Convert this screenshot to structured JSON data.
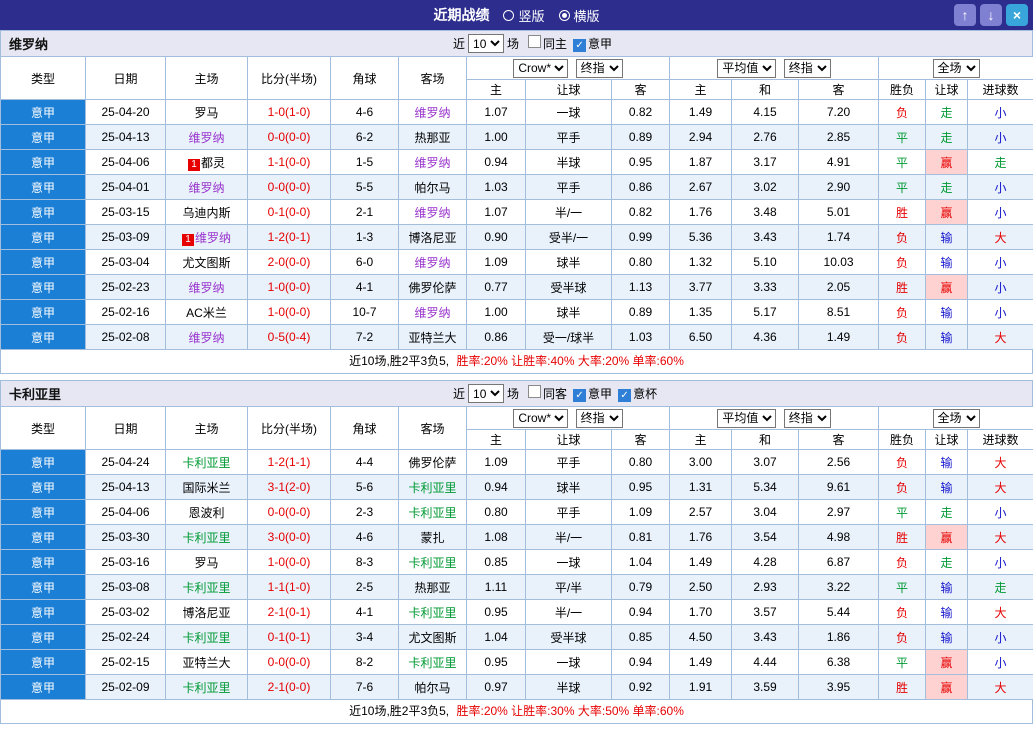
{
  "titlebar": {
    "title": "近期战绩",
    "radios": [
      {
        "label": "竖版",
        "selected": false
      },
      {
        "label": "横版",
        "selected": true
      }
    ],
    "up_icon": "↑",
    "down_icon": "↓",
    "close_icon": "×"
  },
  "colors": {
    "titlebar_bg": "#2d2d8e",
    "league_cell_bg": "#1b7fd6",
    "row_alt_bg": "#e9f2fb",
    "grid_border": "#a3bedc",
    "win_red": "#e60000",
    "draw_green": "#009933",
    "lose_blue": "#1414cc",
    "highlight_pink": "#ffd2d2",
    "team1_color": "#9933cc",
    "team2_color": "#009933"
  },
  "tables": [
    {
      "team": "维罗纳",
      "team_color": "#9933cc",
      "filters": {
        "near_label": "近",
        "count": "10",
        "games_label": "场",
        "checks": [
          {
            "label": "同主",
            "checked": false
          },
          {
            "label": "意甲",
            "checked": true
          }
        ]
      },
      "selects": {
        "g1a": "Crow*",
        "g1b": "终指",
        "g2a": "平均值",
        "g2b": "终指",
        "g3a": "全场"
      },
      "headers": {
        "left": [
          "类型",
          "日期",
          "主场",
          "比分(半场)",
          "角球",
          "客场"
        ],
        "sub": [
          "主",
          "让球",
          "客",
          "主",
          "和",
          "客",
          "胜负",
          "让球",
          "进球数"
        ]
      },
      "rows": [
        {
          "league": "意甲",
          "date": "25-04-20",
          "home": "罗马",
          "home_team": false,
          "home_badge": "",
          "score": "1-0(1-0)",
          "corner": "4-6",
          "away": "维罗纳",
          "away_team": true,
          "away_badge": "",
          "odds": [
            "1.07",
            "一球",
            "0.82"
          ],
          "avg": [
            "1.49",
            "4.15",
            "7.20"
          ],
          "results": [
            {
              "text": "负",
              "color": "red"
            },
            {
              "text": "走",
              "color": "green"
            },
            {
              "text": "小",
              "color": "blue"
            }
          ]
        },
        {
          "league": "意甲",
          "date": "25-04-13",
          "home": "维罗纳",
          "home_team": true,
          "home_badge": "",
          "score": "0-0(0-0)",
          "corner": "6-2",
          "away": "热那亚",
          "away_team": false,
          "away_badge": "",
          "odds": [
            "1.00",
            "平手",
            "0.89"
          ],
          "avg": [
            "2.94",
            "2.76",
            "2.85"
          ],
          "results": [
            {
              "text": "平",
              "color": "green"
            },
            {
              "text": "走",
              "color": "green"
            },
            {
              "text": "小",
              "color": "blue"
            }
          ]
        },
        {
          "league": "意甲",
          "date": "25-04-06",
          "home": "都灵",
          "home_team": false,
          "home_badge": "1",
          "score": "1-1(0-0)",
          "corner": "1-5",
          "away": "维罗纳",
          "away_team": true,
          "away_badge": "",
          "odds": [
            "0.94",
            "半球",
            "0.95"
          ],
          "avg": [
            "1.87",
            "3.17",
            "4.91"
          ],
          "results": [
            {
              "text": "平",
              "color": "green"
            },
            {
              "text": "赢",
              "color": "red",
              "hl": true
            },
            {
              "text": "走",
              "color": "green"
            }
          ]
        },
        {
          "league": "意甲",
          "date": "25-04-01",
          "home": "维罗纳",
          "home_team": true,
          "home_badge": "",
          "score": "0-0(0-0)",
          "corner": "5-5",
          "away": "帕尔马",
          "away_team": false,
          "away_badge": "",
          "odds": [
            "1.03",
            "平手",
            "0.86"
          ],
          "avg": [
            "2.67",
            "3.02",
            "2.90"
          ],
          "results": [
            {
              "text": "平",
              "color": "green"
            },
            {
              "text": "走",
              "color": "green"
            },
            {
              "text": "小",
              "color": "blue"
            }
          ]
        },
        {
          "league": "意甲",
          "date": "25-03-15",
          "home": "乌迪内斯",
          "home_team": false,
          "home_badge": "",
          "score": "0-1(0-0)",
          "corner": "2-1",
          "away": "维罗纳",
          "away_team": true,
          "away_badge": "",
          "odds": [
            "1.07",
            "半/一",
            "0.82"
          ],
          "avg": [
            "1.76",
            "3.48",
            "5.01"
          ],
          "results": [
            {
              "text": "胜",
              "color": "red"
            },
            {
              "text": "赢",
              "color": "red",
              "hl": true
            },
            {
              "text": "小",
              "color": "blue"
            }
          ]
        },
        {
          "league": "意甲",
          "date": "25-03-09",
          "home": "维罗纳",
          "home_team": true,
          "home_badge": "1",
          "score": "1-2(0-1)",
          "corner": "1-3",
          "away": "博洛尼亚",
          "away_team": false,
          "away_badge": "",
          "odds": [
            "0.90",
            "受半/一",
            "0.99"
          ],
          "avg": [
            "5.36",
            "3.43",
            "1.74"
          ],
          "results": [
            {
              "text": "负",
              "color": "red"
            },
            {
              "text": "输",
              "color": "blue"
            },
            {
              "text": "大",
              "color": "red"
            }
          ]
        },
        {
          "league": "意甲",
          "date": "25-03-04",
          "home": "尤文图斯",
          "home_team": false,
          "home_badge": "",
          "score": "2-0(0-0)",
          "corner": "6-0",
          "away": "维罗纳",
          "away_team": true,
          "away_badge": "",
          "odds": [
            "1.09",
            "球半",
            "0.80"
          ],
          "avg": [
            "1.32",
            "5.10",
            "10.03"
          ],
          "results": [
            {
              "text": "负",
              "color": "red"
            },
            {
              "text": "输",
              "color": "blue"
            },
            {
              "text": "小",
              "color": "blue"
            }
          ]
        },
        {
          "league": "意甲",
          "date": "25-02-23",
          "home": "维罗纳",
          "home_team": true,
          "home_badge": "",
          "score": "1-0(0-0)",
          "corner": "4-1",
          "away": "佛罗伦萨",
          "away_team": false,
          "away_badge": "",
          "odds": [
            "0.77",
            "受半球",
            "1.13"
          ],
          "avg": [
            "3.77",
            "3.33",
            "2.05"
          ],
          "results": [
            {
              "text": "胜",
              "color": "red"
            },
            {
              "text": "赢",
              "color": "red",
              "hl": true
            },
            {
              "text": "小",
              "color": "blue"
            }
          ]
        },
        {
          "league": "意甲",
          "date": "25-02-16",
          "home": "AC米兰",
          "home_team": false,
          "home_badge": "",
          "score": "1-0(0-0)",
          "corner": "10-7",
          "away": "维罗纳",
          "away_team": true,
          "away_badge": "",
          "odds": [
            "1.00",
            "球半",
            "0.89"
          ],
          "avg": [
            "1.35",
            "5.17",
            "8.51"
          ],
          "results": [
            {
              "text": "负",
              "color": "red"
            },
            {
              "text": "输",
              "color": "blue"
            },
            {
              "text": "小",
              "color": "blue"
            }
          ]
        },
        {
          "league": "意甲",
          "date": "25-02-08",
          "home": "维罗纳",
          "home_team": true,
          "home_badge": "",
          "score": "0-5(0-4)",
          "corner": "7-2",
          "away": "亚特兰大",
          "away_team": false,
          "away_badge": "",
          "odds": [
            "0.86",
            "受一/球半",
            "1.03"
          ],
          "avg": [
            "6.50",
            "4.36",
            "1.49"
          ],
          "results": [
            {
              "text": "负",
              "color": "red"
            },
            {
              "text": "输",
              "color": "blue"
            },
            {
              "text": "大",
              "color": "red"
            }
          ]
        }
      ],
      "summary": {
        "prefix": "近10场,胜2平3负5,",
        "stats": "胜率:20% 让胜率:40% 大率:20% 单率:60%"
      }
    },
    {
      "team": "卡利亚里",
      "team_color": "#009933",
      "filters": {
        "near_label": "近",
        "count": "10",
        "games_label": "场",
        "checks": [
          {
            "label": "同客",
            "checked": false
          },
          {
            "label": "意甲",
            "checked": true
          },
          {
            "label": "意杯",
            "checked": true
          }
        ]
      },
      "selects": {
        "g1a": "Crow*",
        "g1b": "终指",
        "g2a": "平均值",
        "g2b": "终指",
        "g3a": "全场"
      },
      "headers": {
        "left": [
          "类型",
          "日期",
          "主场",
          "比分(半场)",
          "角球",
          "客场"
        ],
        "sub": [
          "主",
          "让球",
          "客",
          "主",
          "和",
          "客",
          "胜负",
          "让球",
          "进球数"
        ]
      },
      "rows": [
        {
          "league": "意甲",
          "date": "25-04-24",
          "home": "卡利亚里",
          "home_team": true,
          "home_badge": "",
          "score": "1-2(1-1)",
          "corner": "4-4",
          "away": "佛罗伦萨",
          "away_team": false,
          "away_badge": "",
          "odds": [
            "1.09",
            "平手",
            "0.80"
          ],
          "avg": [
            "3.00",
            "3.07",
            "2.56"
          ],
          "results": [
            {
              "text": "负",
              "color": "red"
            },
            {
              "text": "输",
              "color": "blue"
            },
            {
              "text": "大",
              "color": "red"
            }
          ]
        },
        {
          "league": "意甲",
          "date": "25-04-13",
          "home": "国际米兰",
          "home_team": false,
          "home_badge": "",
          "score": "3-1(2-0)",
          "corner": "5-6",
          "away": "卡利亚里",
          "away_team": true,
          "away_badge": "",
          "odds": [
            "0.94",
            "球半",
            "0.95"
          ],
          "avg": [
            "1.31",
            "5.34",
            "9.61"
          ],
          "results": [
            {
              "text": "负",
              "color": "red"
            },
            {
              "text": "输",
              "color": "blue"
            },
            {
              "text": "大",
              "color": "red"
            }
          ]
        },
        {
          "league": "意甲",
          "date": "25-04-06",
          "home": "恩波利",
          "home_team": false,
          "home_badge": "",
          "score": "0-0(0-0)",
          "corner": "2-3",
          "away": "卡利亚里",
          "away_team": true,
          "away_badge": "",
          "odds": [
            "0.80",
            "平手",
            "1.09"
          ],
          "avg": [
            "2.57",
            "3.04",
            "2.97"
          ],
          "results": [
            {
              "text": "平",
              "color": "green"
            },
            {
              "text": "走",
              "color": "green"
            },
            {
              "text": "小",
              "color": "blue"
            }
          ]
        },
        {
          "league": "意甲",
          "date": "25-03-30",
          "home": "卡利亚里",
          "home_team": true,
          "home_badge": "",
          "score": "3-0(0-0)",
          "corner": "4-6",
          "away": "蒙扎",
          "away_team": false,
          "away_badge": "",
          "odds": [
            "1.08",
            "半/一",
            "0.81"
          ],
          "avg": [
            "1.76",
            "3.54",
            "4.98"
          ],
          "results": [
            {
              "text": "胜",
              "color": "red"
            },
            {
              "text": "赢",
              "color": "red",
              "hl": true
            },
            {
              "text": "大",
              "color": "red"
            }
          ]
        },
        {
          "league": "意甲",
          "date": "25-03-16",
          "home": "罗马",
          "home_team": false,
          "home_badge": "",
          "score": "1-0(0-0)",
          "corner": "8-3",
          "away": "卡利亚里",
          "away_team": true,
          "away_badge": "",
          "odds": [
            "0.85",
            "一球",
            "1.04"
          ],
          "avg": [
            "1.49",
            "4.28",
            "6.87"
          ],
          "results": [
            {
              "text": "负",
              "color": "red"
            },
            {
              "text": "走",
              "color": "green"
            },
            {
              "text": "小",
              "color": "blue"
            }
          ]
        },
        {
          "league": "意甲",
          "date": "25-03-08",
          "home": "卡利亚里",
          "home_team": true,
          "home_badge": "",
          "score": "1-1(1-0)",
          "corner": "2-5",
          "away": "热那亚",
          "away_team": false,
          "away_badge": "",
          "odds": [
            "1.11",
            "平/半",
            "0.79"
          ],
          "avg": [
            "2.50",
            "2.93",
            "3.22"
          ],
          "results": [
            {
              "text": "平",
              "color": "green"
            },
            {
              "text": "输",
              "color": "blue"
            },
            {
              "text": "走",
              "color": "green"
            }
          ]
        },
        {
          "league": "意甲",
          "date": "25-03-02",
          "home": "博洛尼亚",
          "home_team": false,
          "home_badge": "",
          "score": "2-1(0-1)",
          "corner": "4-1",
          "away": "卡利亚里",
          "away_team": true,
          "away_badge": "",
          "odds": [
            "0.95",
            "半/一",
            "0.94"
          ],
          "avg": [
            "1.70",
            "3.57",
            "5.44"
          ],
          "results": [
            {
              "text": "负",
              "color": "red"
            },
            {
              "text": "输",
              "color": "blue"
            },
            {
              "text": "大",
              "color": "red"
            }
          ]
        },
        {
          "league": "意甲",
          "date": "25-02-24",
          "home": "卡利亚里",
          "home_team": true,
          "home_badge": "",
          "score": "0-1(0-1)",
          "corner": "3-4",
          "away": "尤文图斯",
          "away_team": false,
          "away_badge": "",
          "odds": [
            "1.04",
            "受半球",
            "0.85"
          ],
          "avg": [
            "4.50",
            "3.43",
            "1.86"
          ],
          "results": [
            {
              "text": "负",
              "color": "red"
            },
            {
              "text": "输",
              "color": "blue"
            },
            {
              "text": "小",
              "color": "blue"
            }
          ]
        },
        {
          "league": "意甲",
          "date": "25-02-15",
          "home": "亚特兰大",
          "home_team": false,
          "home_badge": "",
          "score": "0-0(0-0)",
          "corner": "8-2",
          "away": "卡利亚里",
          "away_team": true,
          "away_badge": "",
          "odds": [
            "0.95",
            "一球",
            "0.94"
          ],
          "avg": [
            "1.49",
            "4.44",
            "6.38"
          ],
          "results": [
            {
              "text": "平",
              "color": "green"
            },
            {
              "text": "赢",
              "color": "red",
              "hl": true
            },
            {
              "text": "小",
              "color": "blue"
            }
          ]
        },
        {
          "league": "意甲",
          "date": "25-02-09",
          "home": "卡利亚里",
          "home_team": true,
          "home_badge": "",
          "score": "2-1(0-0)",
          "corner": "7-6",
          "away": "帕尔马",
          "away_team": false,
          "away_badge": "",
          "odds": [
            "0.97",
            "半球",
            "0.92"
          ],
          "avg": [
            "1.91",
            "3.59",
            "3.95"
          ],
          "results": [
            {
              "text": "胜",
              "color": "red"
            },
            {
              "text": "赢",
              "color": "red",
              "hl": true
            },
            {
              "text": "大",
              "color": "red"
            }
          ]
        }
      ],
      "summary": {
        "prefix": "近10场,胜2平3负5,",
        "stats": "胜率:20% 让胜率:30% 大率:50% 单率:60%"
      }
    }
  ]
}
